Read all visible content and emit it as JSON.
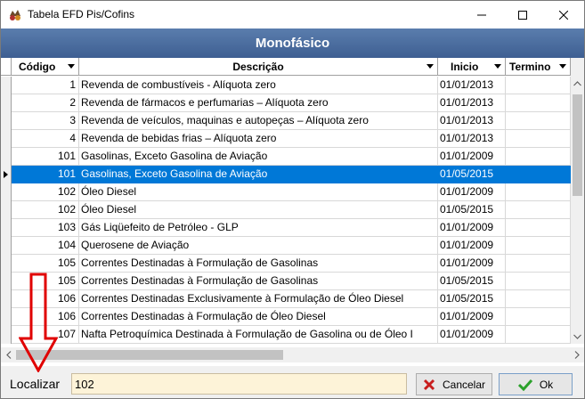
{
  "window": {
    "title": "Tabela EFD Pis/Cofins",
    "icons": {
      "app": "app-icon",
      "minimize": "minimize-icon",
      "maximize": "maximize-icon",
      "close": "close-icon"
    }
  },
  "grid": {
    "banner": "Monofásico",
    "columns": [
      {
        "key": "codigo",
        "label": "Código"
      },
      {
        "key": "descricao",
        "label": "Descrição"
      },
      {
        "key": "inicio",
        "label": "Inicio"
      },
      {
        "key": "termino",
        "label": "Termino"
      }
    ],
    "selected_row_index": 5,
    "rows": [
      {
        "codigo": "1",
        "descricao": "Revenda de combustíveis - Alíquota zero",
        "inicio": "01/01/2013",
        "termino": ""
      },
      {
        "codigo": "2",
        "descricao": "Revenda de fármacos e perfumarias – Alíquota zero",
        "inicio": "01/01/2013",
        "termino": ""
      },
      {
        "codigo": "3",
        "descricao": "Revenda de veículos, maquinas e autopeças – Alíquota zero",
        "inicio": "01/01/2013",
        "termino": ""
      },
      {
        "codigo": "4",
        "descricao": "Revenda de bebidas frias – Alíquota zero",
        "inicio": "01/01/2013",
        "termino": ""
      },
      {
        "codigo": "101",
        "descricao": "Gasolinas, Exceto Gasolina de Aviação",
        "inicio": "01/01/2009",
        "termino": ""
      },
      {
        "codigo": "101",
        "descricao": "Gasolinas, Exceto Gasolina de Aviação",
        "inicio": "01/05/2015",
        "termino": ""
      },
      {
        "codigo": "102",
        "descricao": "Óleo Diesel",
        "inicio": "01/01/2009",
        "termino": ""
      },
      {
        "codigo": "102",
        "descricao": "Óleo Diesel",
        "inicio": "01/05/2015",
        "termino": ""
      },
      {
        "codigo": "103",
        "descricao": "Gás Liqüefeito de Petróleo - GLP",
        "inicio": "01/01/2009",
        "termino": ""
      },
      {
        "codigo": "104",
        "descricao": "Querosene de Aviação",
        "inicio": "01/01/2009",
        "termino": ""
      },
      {
        "codigo": "105",
        "descricao": "Correntes Destinadas à Formulação de Gasolinas",
        "inicio": "01/01/2009",
        "termino": ""
      },
      {
        "codigo": "105",
        "descricao": "Correntes Destinadas à Formulação de Gasolinas",
        "inicio": "01/05/2015",
        "termino": ""
      },
      {
        "codigo": "106",
        "descricao": "Correntes Destinadas Exclusivamente à Formulação de Óleo Diesel",
        "inicio": "01/05/2015",
        "termino": ""
      },
      {
        "codigo": "106",
        "descricao": "Correntes Destinadas à Formulação de Óleo Diesel",
        "inicio": "01/01/2009",
        "termino": ""
      },
      {
        "codigo": "107",
        "descricao": "Nafta Petroquímica Destinada à Formulação de Gasolina ou de Óleo I",
        "inicio": "01/01/2009",
        "termino": ""
      }
    ]
  },
  "search": {
    "label": "Localizar",
    "value": "102"
  },
  "buttons": {
    "cancel": {
      "label": "Cancelar",
      "icon": "x-icon"
    },
    "ok": {
      "label": "Ok",
      "icon": "check-icon"
    }
  },
  "colors": {
    "banner": "#4a6da0",
    "selection": "#0078d7",
    "annotation_arrow": "#e00000",
    "search_background": "#fdf3d8"
  }
}
